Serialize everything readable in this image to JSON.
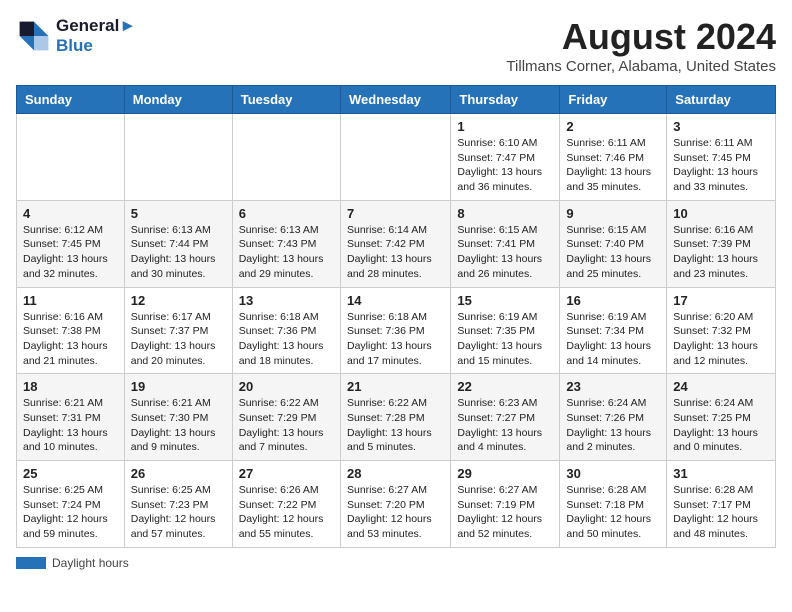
{
  "header": {
    "logo_line1": "General",
    "logo_line2": "Blue",
    "month_year": "August 2024",
    "location": "Tillmans Corner, Alabama, United States"
  },
  "days_of_week": [
    "Sunday",
    "Monday",
    "Tuesday",
    "Wednesday",
    "Thursday",
    "Friday",
    "Saturday"
  ],
  "weeks": [
    [
      {
        "day": "",
        "info": ""
      },
      {
        "day": "",
        "info": ""
      },
      {
        "day": "",
        "info": ""
      },
      {
        "day": "",
        "info": ""
      },
      {
        "day": "1",
        "info": "Sunrise: 6:10 AM\nSunset: 7:47 PM\nDaylight: 13 hours and 36 minutes."
      },
      {
        "day": "2",
        "info": "Sunrise: 6:11 AM\nSunset: 7:46 PM\nDaylight: 13 hours and 35 minutes."
      },
      {
        "day": "3",
        "info": "Sunrise: 6:11 AM\nSunset: 7:45 PM\nDaylight: 13 hours and 33 minutes."
      }
    ],
    [
      {
        "day": "4",
        "info": "Sunrise: 6:12 AM\nSunset: 7:45 PM\nDaylight: 13 hours and 32 minutes."
      },
      {
        "day": "5",
        "info": "Sunrise: 6:13 AM\nSunset: 7:44 PM\nDaylight: 13 hours and 30 minutes."
      },
      {
        "day": "6",
        "info": "Sunrise: 6:13 AM\nSunset: 7:43 PM\nDaylight: 13 hours and 29 minutes."
      },
      {
        "day": "7",
        "info": "Sunrise: 6:14 AM\nSunset: 7:42 PM\nDaylight: 13 hours and 28 minutes."
      },
      {
        "day": "8",
        "info": "Sunrise: 6:15 AM\nSunset: 7:41 PM\nDaylight: 13 hours and 26 minutes."
      },
      {
        "day": "9",
        "info": "Sunrise: 6:15 AM\nSunset: 7:40 PM\nDaylight: 13 hours and 25 minutes."
      },
      {
        "day": "10",
        "info": "Sunrise: 6:16 AM\nSunset: 7:39 PM\nDaylight: 13 hours and 23 minutes."
      }
    ],
    [
      {
        "day": "11",
        "info": "Sunrise: 6:16 AM\nSunset: 7:38 PM\nDaylight: 13 hours and 21 minutes."
      },
      {
        "day": "12",
        "info": "Sunrise: 6:17 AM\nSunset: 7:37 PM\nDaylight: 13 hours and 20 minutes."
      },
      {
        "day": "13",
        "info": "Sunrise: 6:18 AM\nSunset: 7:36 PM\nDaylight: 13 hours and 18 minutes."
      },
      {
        "day": "14",
        "info": "Sunrise: 6:18 AM\nSunset: 7:36 PM\nDaylight: 13 hours and 17 minutes."
      },
      {
        "day": "15",
        "info": "Sunrise: 6:19 AM\nSunset: 7:35 PM\nDaylight: 13 hours and 15 minutes."
      },
      {
        "day": "16",
        "info": "Sunrise: 6:19 AM\nSunset: 7:34 PM\nDaylight: 13 hours and 14 minutes."
      },
      {
        "day": "17",
        "info": "Sunrise: 6:20 AM\nSunset: 7:32 PM\nDaylight: 13 hours and 12 minutes."
      }
    ],
    [
      {
        "day": "18",
        "info": "Sunrise: 6:21 AM\nSunset: 7:31 PM\nDaylight: 13 hours and 10 minutes."
      },
      {
        "day": "19",
        "info": "Sunrise: 6:21 AM\nSunset: 7:30 PM\nDaylight: 13 hours and 9 minutes."
      },
      {
        "day": "20",
        "info": "Sunrise: 6:22 AM\nSunset: 7:29 PM\nDaylight: 13 hours and 7 minutes."
      },
      {
        "day": "21",
        "info": "Sunrise: 6:22 AM\nSunset: 7:28 PM\nDaylight: 13 hours and 5 minutes."
      },
      {
        "day": "22",
        "info": "Sunrise: 6:23 AM\nSunset: 7:27 PM\nDaylight: 13 hours and 4 minutes."
      },
      {
        "day": "23",
        "info": "Sunrise: 6:24 AM\nSunset: 7:26 PM\nDaylight: 13 hours and 2 minutes."
      },
      {
        "day": "24",
        "info": "Sunrise: 6:24 AM\nSunset: 7:25 PM\nDaylight: 13 hours and 0 minutes."
      }
    ],
    [
      {
        "day": "25",
        "info": "Sunrise: 6:25 AM\nSunset: 7:24 PM\nDaylight: 12 hours and 59 minutes."
      },
      {
        "day": "26",
        "info": "Sunrise: 6:25 AM\nSunset: 7:23 PM\nDaylight: 12 hours and 57 minutes."
      },
      {
        "day": "27",
        "info": "Sunrise: 6:26 AM\nSunset: 7:22 PM\nDaylight: 12 hours and 55 minutes."
      },
      {
        "day": "28",
        "info": "Sunrise: 6:27 AM\nSunset: 7:20 PM\nDaylight: 12 hours and 53 minutes."
      },
      {
        "day": "29",
        "info": "Sunrise: 6:27 AM\nSunset: 7:19 PM\nDaylight: 12 hours and 52 minutes."
      },
      {
        "day": "30",
        "info": "Sunrise: 6:28 AM\nSunset: 7:18 PM\nDaylight: 12 hours and 50 minutes."
      },
      {
        "day": "31",
        "info": "Sunrise: 6:28 AM\nSunset: 7:17 PM\nDaylight: 12 hours and 48 minutes."
      }
    ]
  ],
  "legend": {
    "label": "Daylight hours"
  }
}
